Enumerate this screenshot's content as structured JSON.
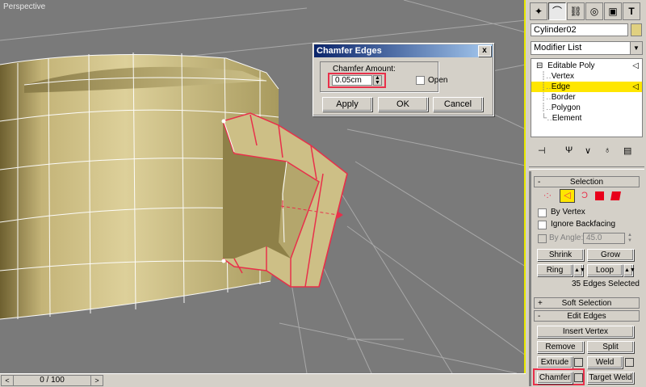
{
  "viewport": {
    "label": "Perspective"
  },
  "timeline": {
    "frame": "0 / 100",
    "prev": "<",
    "next": ">"
  },
  "dialog": {
    "title": "Chamfer Edges",
    "close": "x",
    "amount_label": "Chamfer Amount:",
    "amount_value": "0.05cm",
    "open_label": "Open",
    "apply": "Apply",
    "ok": "OK",
    "cancel": "Cancel"
  },
  "panel": {
    "tabs": [
      "create-icon",
      "modify-icon",
      "hierarchy-icon",
      "motion-icon",
      "display-icon",
      "utilities-icon"
    ],
    "object_name": "Cylinder02",
    "object_color": "#e0d080",
    "modifier_list": "Modifier List",
    "stack": {
      "root": "Editable Poly",
      "items": [
        "Vertex",
        "Edge",
        "Border",
        "Polygon",
        "Element"
      ],
      "selected": "Edge"
    },
    "selection": {
      "title": "Selection",
      "by_vertex": "By Vertex",
      "ignore_backfacing": "Ignore Backfacing",
      "by_angle": "By Angle:",
      "angle_value": "45.0",
      "shrink": "Shrink",
      "grow": "Grow",
      "ring": "Ring",
      "loop": "Loop",
      "status": "35 Edges Selected"
    },
    "soft_selection": {
      "title": "Soft Selection"
    },
    "edit_edges": {
      "title": "Edit Edges",
      "insert_vertex": "Insert Vertex",
      "remove": "Remove",
      "split": "Split",
      "extrude": "Extrude",
      "weld": "Weld",
      "chamfer": "Chamfer",
      "target_weld": "Target Weld"
    }
  },
  "colors": {
    "selection_red": "#e8304a",
    "highlight_yellow": "#ffe600",
    "titlebar": "#0a246a"
  }
}
